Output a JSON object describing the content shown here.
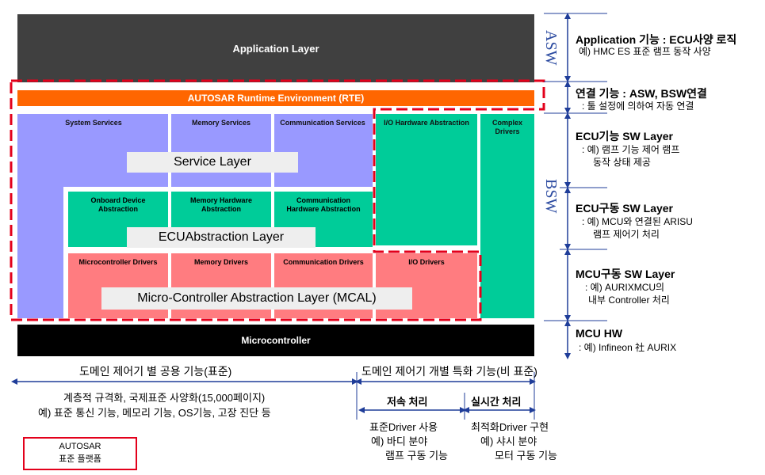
{
  "layers": {
    "application": "Application Layer",
    "rte": "AUTOSAR Runtime Environment (RTE)",
    "microcontroller": "Microcontroller"
  },
  "services": {
    "system": "System Services",
    "memory": "Memory Services",
    "communication": "Communication Services",
    "io_hw": "I/O Hardware Abstraction",
    "complex": "Complex Drivers",
    "panel": "Service Layer"
  },
  "ecu_abstraction": {
    "onboard": "Onboard Device Abstraction",
    "memory_hw": "Memory Hardware Abstraction",
    "comm_hw": "Communication Hardware Abstraction",
    "panel": "ECUAbstraction Layer"
  },
  "mcal": {
    "micro_drivers": "Microcontroller Drivers",
    "memory_drivers": "Memory Drivers",
    "comm_drivers": "Communication Drivers",
    "io_drivers": "I/O Drivers",
    "panel": "Micro-Controller Abstraction Layer (MCAL)"
  },
  "side_labels": {
    "asw": "ASW",
    "bsw": "BSW"
  },
  "right_desc": [
    {
      "title": "Application 기능 : ECU사양 로직",
      "lines": [
        "예) HMC ES 표준 램프 동작 사양"
      ]
    },
    {
      "title": "연결 기능 : ASW, BSW연결",
      "lines": [
        ": 툴 설정에 의하여 자동 연결"
      ]
    },
    {
      "title": "ECU기능 SW Layer",
      "lines": [
        ": 예) 램프 기능 제어 램프",
        "동작 상태 제공"
      ]
    },
    {
      "title": "ECU구동 SW Layer",
      "lines": [
        ": 예) MCU와 연결된 ARISU",
        "램프 제어기 처리"
      ]
    },
    {
      "title": "MCU구동 SW Layer",
      "lines": [
        ": 예) AURIXMCU의",
        "내부 Controller 처리"
      ]
    },
    {
      "title": "MCU HW",
      "lines": [
        ": 예) Infineon 社 AURIX"
      ]
    }
  ],
  "bottom": {
    "domain_common": "도메인 제어기 별 공용 기능(표준)",
    "domain_specific": "도메인 제어기 개별 특화 기능(비 표준)",
    "common_line1": "계층적 규격화, 국제표준 사양화(15,000페이지)",
    "common_line2": "예) 표준 통신 기능, 메모리 기능, OS기능, 고장 진단 등",
    "low_speed": "저속 처리",
    "realtime": "실시간 처리",
    "low_speed_desc": [
      "표준Driver 사용",
      "예) 바디 분야",
      "램프 구동 기능"
    ],
    "realtime_desc": [
      "최적화Driver 구현",
      "예) 샤시 분야",
      "모터 구동 기능"
    ],
    "legend": [
      "AUTOSAR",
      "표준 플랫폼"
    ]
  },
  "colors": {
    "application": "#404040",
    "rte": "#ff6600",
    "purple": "#9999ff",
    "green": "#00cc99",
    "pink": "#ff7c80",
    "dash_red": "#e3001b",
    "arrow_blue": "#1f3d99"
  }
}
